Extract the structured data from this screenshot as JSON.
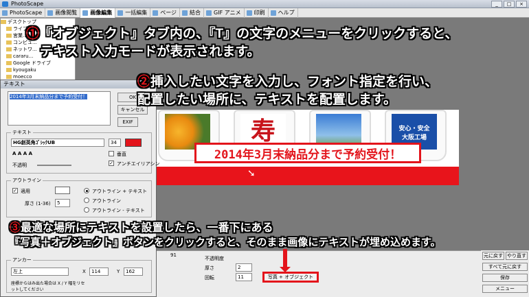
{
  "window": {
    "title": "PhotoScape",
    "min": "_",
    "max": "□",
    "close": "×"
  },
  "tabs": [
    "PhotoScape",
    "画像閲覧",
    "画像編集",
    "一括編集",
    "ページ",
    "結合",
    "GIF アニメ",
    "印刷",
    "ヘルプ"
  ],
  "tree": [
    "デスクトップ",
    "ライブ...",
    "宮業...",
    "コンピュ...",
    "ネットワ...",
    "cararu...",
    "Google ドライブ",
    "kyougaku",
    "moecco",
    "Originals"
  ],
  "dialog": {
    "title": "テキスト",
    "text_value": "2014年3月末納品分まで予約受付！",
    "ok": "OK",
    "cancel": "キャンセル",
    "exif": "EXIF",
    "text_group": "テキスト",
    "font": "HG創英角ｺﾞｼｯｸUB",
    "font_size": "34",
    "vertical": "垂直",
    "opacity": "不透明",
    "antialias": "アンチエイリアシン",
    "outline_group": "アウトライン",
    "apply": "適用",
    "outline_text": "アウトライン + テキスト",
    "outline_only": "アウトライン",
    "outline_minus": "アウトライン - テキスト",
    "thickness_label": "厚さ (1-36)",
    "thickness": "5",
    "anchor_group": "アンカー",
    "anchor_value": "左上",
    "x_label": "X",
    "x_value": "114",
    "y_label": "Y",
    "y_value": "162",
    "reset_note": "座標からはみ出た場合は X / Y 幅をリセットしてください"
  },
  "canvas": {
    "caption": "2014年3月末納品分まで予約受付！",
    "mug_text": "寿",
    "mug3_line1": "安心・安全",
    "mug3_line2": "大阪工場"
  },
  "bottom": {
    "photo_object": "写真 + オブジェクト",
    "opacity": "不透明度",
    "thickness": "厚さ",
    "rotate": "回転",
    "num_2": "2",
    "num_11": "11",
    "num_91": "91"
  },
  "right": {
    "undo": "元に戻す",
    "redo": "やり直す",
    "undo_all": "すべて元に戻す",
    "save": "保存",
    "menu": "メニュー"
  },
  "annotations": {
    "a1_num": "①",
    "a1_line1": "『オブジェクト』タブ内の、『T』の文字のメニューをクリックすると、",
    "a1_line2": "テキスト入力モードが表示されます。",
    "a2_num": "②",
    "a2_line1": "挿入したい文字を入力し、フォント指定を行い、",
    "a2_line2": "配置したい場所に、テキストを配置します。",
    "a3_num": "③",
    "a3_line1": "最適な場所にテキストを設置したら、一番下にある",
    "a3_line2": "『写真＋オブジェクト』ボタンをクリックすると、そのまま画像にテキストが埋め込めます。"
  },
  "colors": {
    "accent_red": "#e3141b",
    "annotation_text": "#ffffff"
  }
}
